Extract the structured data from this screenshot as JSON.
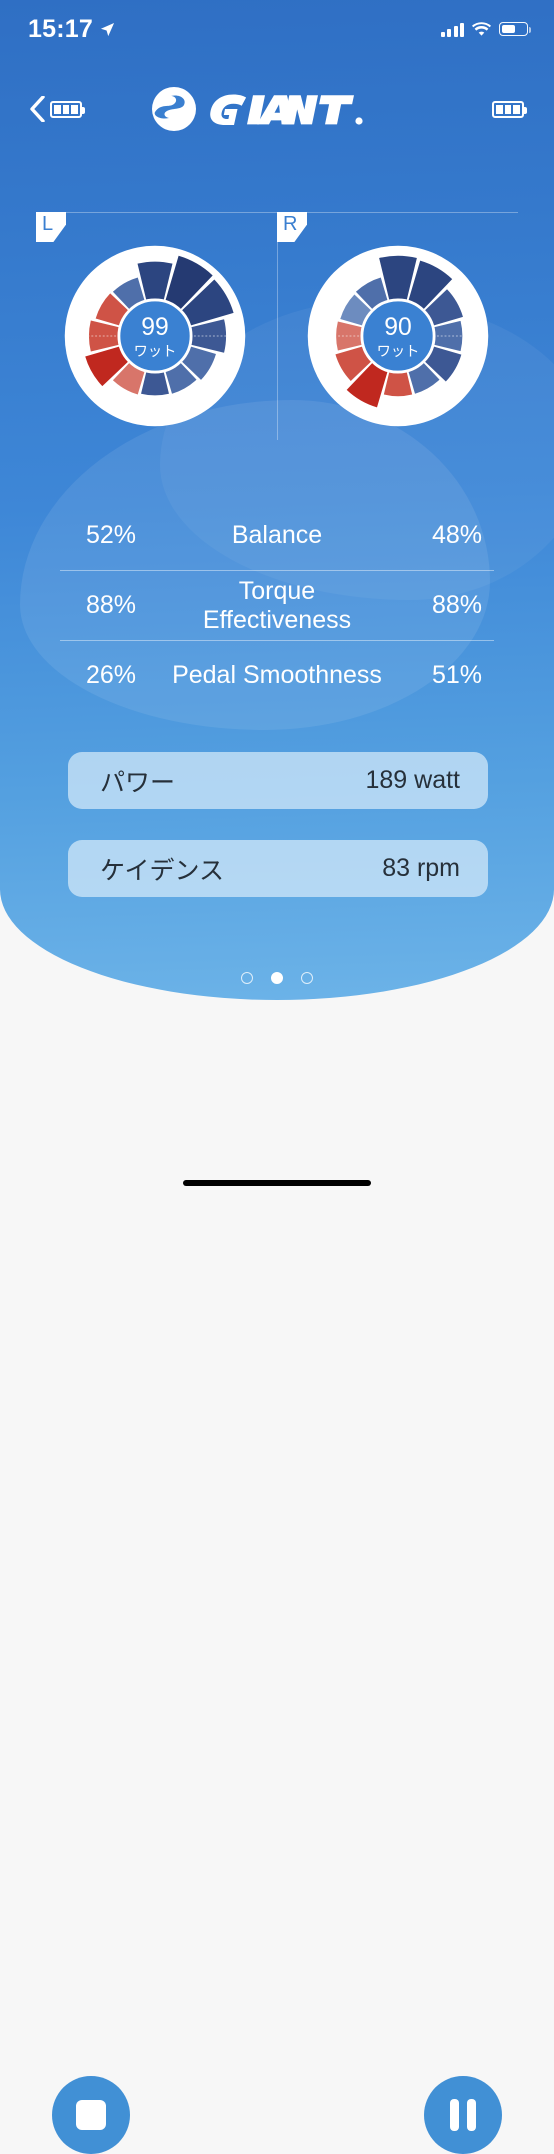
{
  "status_bar": {
    "time": "15:17",
    "location_icon": "location-arrow-icon",
    "signal_icon": "cellular-signal-icon",
    "wifi_icon": "wifi-icon",
    "battery_icon": "battery-icon",
    "battery_level_pct": 55
  },
  "header": {
    "back_icon": "chevron-left-icon",
    "left_device_battery_icon": "device-battery-icon",
    "left_device_battery_bars": 3,
    "brand_mark_icon": "giant-swoosh-logo-icon",
    "brand_name": "GIANT",
    "brand_trademark": "®",
    "right_device_battery_icon": "device-battery-icon",
    "right_device_battery_bars": 3
  },
  "pedals": {
    "left": {
      "side_label": "L",
      "value": "99",
      "unit": "ワット"
    },
    "right": {
      "side_label": "R",
      "value": "90",
      "unit": "ワット"
    }
  },
  "metrics": {
    "rows": [
      {
        "left": "52%",
        "name": "Balance",
        "right": "48%"
      },
      {
        "left": "88%",
        "name": "Torque Effectiveness",
        "right": "88%"
      },
      {
        "left": "26%",
        "name": "Pedal Smoothness",
        "right": "51%"
      }
    ]
  },
  "info_pills": [
    {
      "label": "パワー",
      "value": "189 watt"
    },
    {
      "label": "ケイデンス",
      "value": "83 rpm"
    }
  ],
  "pagination": {
    "count": 3,
    "active_index": 1
  },
  "controls": {
    "stop_label": "stop-button",
    "stop_icon": "stop-square-icon",
    "pause_label": "pause-button",
    "pause_icon": "pause-bars-icon"
  },
  "colors": {
    "bg_top": "#2f6fc4",
    "bg_bottom": "#6cb3e8",
    "accent_button": "#4190d5",
    "pill_bg": "#9cc8ea",
    "dial_face": "#ffffff",
    "center_fill": "#3a81d2",
    "red_strong": "#c0281f",
    "red_mid": "#cf5346",
    "red_light": "#d8756a",
    "blue_deep": "#253a72",
    "blue_dark": "#2c4580",
    "blue_mid": "#3d5894",
    "blue_soft": "#4f6faa",
    "blue_pale": "#6d8cbf"
  },
  "chart_data": [
    {
      "type": "pie",
      "title": "Left pedal power distribution",
      "center_value": "99",
      "center_unit": "ワット",
      "note": "Radial sector chart, 12 sectors of 30° each; sector radius encodes relative force magnitude; red sectors indicate negative/resistive force, blue sectors indicate positive force.",
      "segments": [
        {
          "index": 0,
          "start_deg": -15,
          "end_deg": 15,
          "radius_pct": 78,
          "color": "#2c4580",
          "polarity": "positive"
        },
        {
          "index": 1,
          "start_deg": 15,
          "end_deg": 45,
          "radius_pct": 100,
          "color": "#253a72",
          "polarity": "positive"
        },
        {
          "index": 2,
          "start_deg": 45,
          "end_deg": 75,
          "radius_pct": 96,
          "color": "#2c4580",
          "polarity": "positive"
        },
        {
          "index": 3,
          "start_deg": 75,
          "end_deg": 105,
          "radius_pct": 70,
          "color": "#3d5894",
          "polarity": "positive"
        },
        {
          "index": 4,
          "start_deg": 105,
          "end_deg": 135,
          "radius_pct": 52,
          "color": "#4f6faa",
          "polarity": "positive"
        },
        {
          "index": 5,
          "start_deg": 135,
          "end_deg": 165,
          "radius_pct": 44,
          "color": "#4f6faa",
          "polarity": "positive"
        },
        {
          "index": 6,
          "start_deg": 165,
          "end_deg": 195,
          "radius_pct": 42,
          "color": "#3d5894",
          "polarity": "positive"
        },
        {
          "index": 7,
          "start_deg": 195,
          "end_deg": 225,
          "radius_pct": 46,
          "color": "#d8756a",
          "polarity": "negative"
        },
        {
          "index": 8,
          "start_deg": 225,
          "end_deg": 255,
          "radius_pct": 74,
          "color": "#c0281f",
          "polarity": "negative"
        },
        {
          "index": 9,
          "start_deg": 255,
          "end_deg": 285,
          "radius_pct": 58,
          "color": "#cf5346",
          "polarity": "negative"
        },
        {
          "index": 10,
          "start_deg": 285,
          "end_deg": 315,
          "radius_pct": 48,
          "color": "#cf5346",
          "polarity": "negative"
        },
        {
          "index": 11,
          "start_deg": 315,
          "end_deg": 345,
          "radius_pct": 46,
          "color": "#4f6faa",
          "polarity": "positive"
        }
      ]
    },
    {
      "type": "pie",
      "title": "Right pedal power distribution",
      "center_value": "90",
      "center_unit": "ワット",
      "note": "Radial sector chart, 12 sectors of 30° each; sector radius encodes relative force magnitude; red sectors indicate negative/resistive force, blue sectors indicate positive force.",
      "segments": [
        {
          "index": 0,
          "start_deg": -15,
          "end_deg": 15,
          "radius_pct": 92,
          "color": "#2c4580",
          "polarity": "positive"
        },
        {
          "index": 1,
          "start_deg": 15,
          "end_deg": 45,
          "radius_pct": 88,
          "color": "#2c4580",
          "polarity": "positive"
        },
        {
          "index": 2,
          "start_deg": 45,
          "end_deg": 75,
          "radius_pct": 62,
          "color": "#3d5894",
          "polarity": "positive"
        },
        {
          "index": 3,
          "start_deg": 75,
          "end_deg": 105,
          "radius_pct": 54,
          "color": "#4f6faa",
          "polarity": "positive"
        },
        {
          "index": 4,
          "start_deg": 105,
          "end_deg": 135,
          "radius_pct": 58,
          "color": "#3d5894",
          "polarity": "positive"
        },
        {
          "index": 5,
          "start_deg": 135,
          "end_deg": 165,
          "radius_pct": 44,
          "color": "#4f6faa",
          "polarity": "positive"
        },
        {
          "index": 6,
          "start_deg": 165,
          "end_deg": 195,
          "radius_pct": 44,
          "color": "#cf5346",
          "polarity": "negative"
        },
        {
          "index": 7,
          "start_deg": 195,
          "end_deg": 225,
          "radius_pct": 78,
          "color": "#c0281f",
          "polarity": "negative"
        },
        {
          "index": 8,
          "start_deg": 225,
          "end_deg": 255,
          "radius_pct": 56,
          "color": "#cf5346",
          "polarity": "negative"
        },
        {
          "index": 9,
          "start_deg": 255,
          "end_deg": 285,
          "radius_pct": 48,
          "color": "#d8756a",
          "polarity": "negative"
        },
        {
          "index": 10,
          "start_deg": 285,
          "end_deg": 315,
          "radius_pct": 44,
          "color": "#6d8cbf",
          "polarity": "positive"
        },
        {
          "index": 11,
          "start_deg": 315,
          "end_deg": 345,
          "radius_pct": 46,
          "color": "#4f6faa",
          "polarity": "positive"
        }
      ]
    }
  ]
}
